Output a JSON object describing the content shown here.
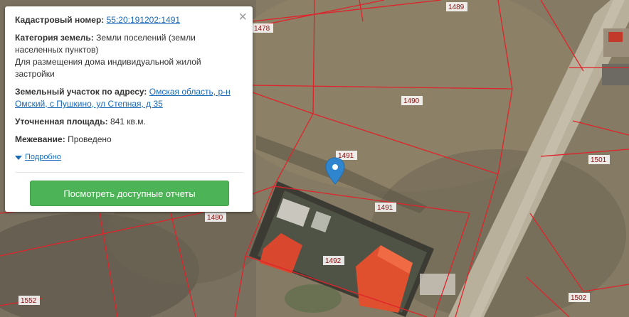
{
  "popup": {
    "close_label": "×",
    "cadastral_label": "Кадастровый номер:",
    "cadastral_value": "55:20:191202:1491",
    "category_label": "Категория земель:",
    "category_value": "Земли поселений (земли населенных пунктов)",
    "usage_value": "Для размещения дома индивидуальной жилой застройки",
    "address_label": "Земельный участок по адресу:",
    "address_value": "Омская область, р-н Омский, с Пушкино, ул Степная, д 35",
    "area_label": "Уточненная площадь:",
    "area_value": "841 кв.м.",
    "survey_label": "Межевание:",
    "survey_value": "Проведено",
    "details_label": "Подробно",
    "report_button": "Посмотреть доступные отчеты"
  },
  "map": {
    "parcel_labels": [
      "1489",
      "1478",
      "1490",
      "1491",
      "1491",
      "1501",
      "1480",
      "1492",
      "1552",
      "1502"
    ],
    "boundary_color": "#e0232a",
    "marker_color": "#2f86cf",
    "icon": "map-marker-icon"
  }
}
